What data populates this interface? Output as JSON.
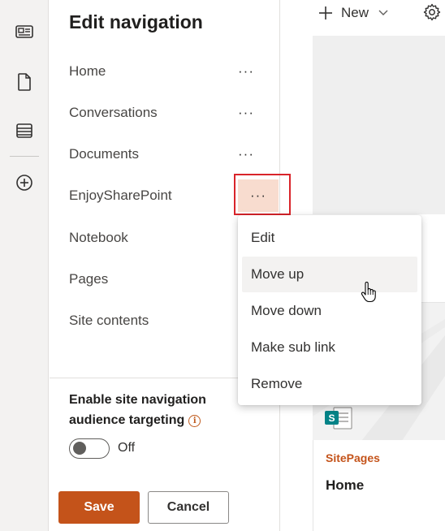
{
  "rail": {
    "icons": [
      "news-icon",
      "document-icon",
      "list-icon",
      "add-circle-icon"
    ]
  },
  "panel": {
    "title": "Edit navigation",
    "nav_items": [
      {
        "label": "Home"
      },
      {
        "label": "Conversations"
      },
      {
        "label": "Documents"
      },
      {
        "label": "EnjoySharePoint"
      },
      {
        "label": "Notebook"
      },
      {
        "label": "Pages"
      },
      {
        "label": "Site contents"
      }
    ],
    "more_glyph": "···",
    "audience_label": "Enable site navigation audience targeting",
    "toggle_label": "Off",
    "toggle_on": false,
    "save_label": "Save",
    "cancel_label": "Cancel"
  },
  "context_menu": {
    "items": [
      {
        "label": "Edit"
      },
      {
        "label": "Move up"
      },
      {
        "label": "Move down"
      },
      {
        "label": "Make sub link"
      },
      {
        "label": "Remove"
      }
    ],
    "hovered": "Move up"
  },
  "command_bar": {
    "new_label": "New"
  },
  "card": {
    "category": "SitePages",
    "title": "Home"
  },
  "colors": {
    "accent": "#c4531a",
    "highlight_border": "#d9242a",
    "active_more_bg": "#f8dccf"
  }
}
